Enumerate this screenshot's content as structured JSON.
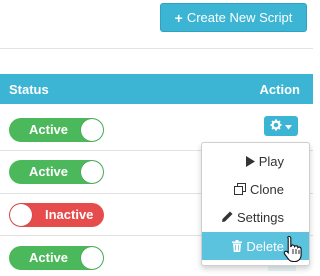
{
  "toolbar": {
    "create_label": "Create New Script"
  },
  "table": {
    "headers": {
      "status": "Status",
      "action": "Action"
    },
    "rows": [
      {
        "status": "Active",
        "state": "on"
      },
      {
        "status": "Active",
        "state": "on"
      },
      {
        "status": "Inactive",
        "state": "off"
      },
      {
        "status": "Active",
        "state": "on"
      }
    ]
  },
  "action_menu": {
    "items": [
      {
        "label": "Play",
        "icon": "play-icon"
      },
      {
        "label": "Clone",
        "icon": "clone-icon"
      },
      {
        "label": "Settings",
        "icon": "pencil-icon"
      },
      {
        "label": "Delete",
        "icon": "trash-icon",
        "highlighted": true
      }
    ]
  },
  "colors": {
    "accent": "#3cb5d5",
    "active_green": "#4cb85c",
    "inactive_red": "#e74c4c",
    "menu_highlight": "#5bc3de"
  }
}
